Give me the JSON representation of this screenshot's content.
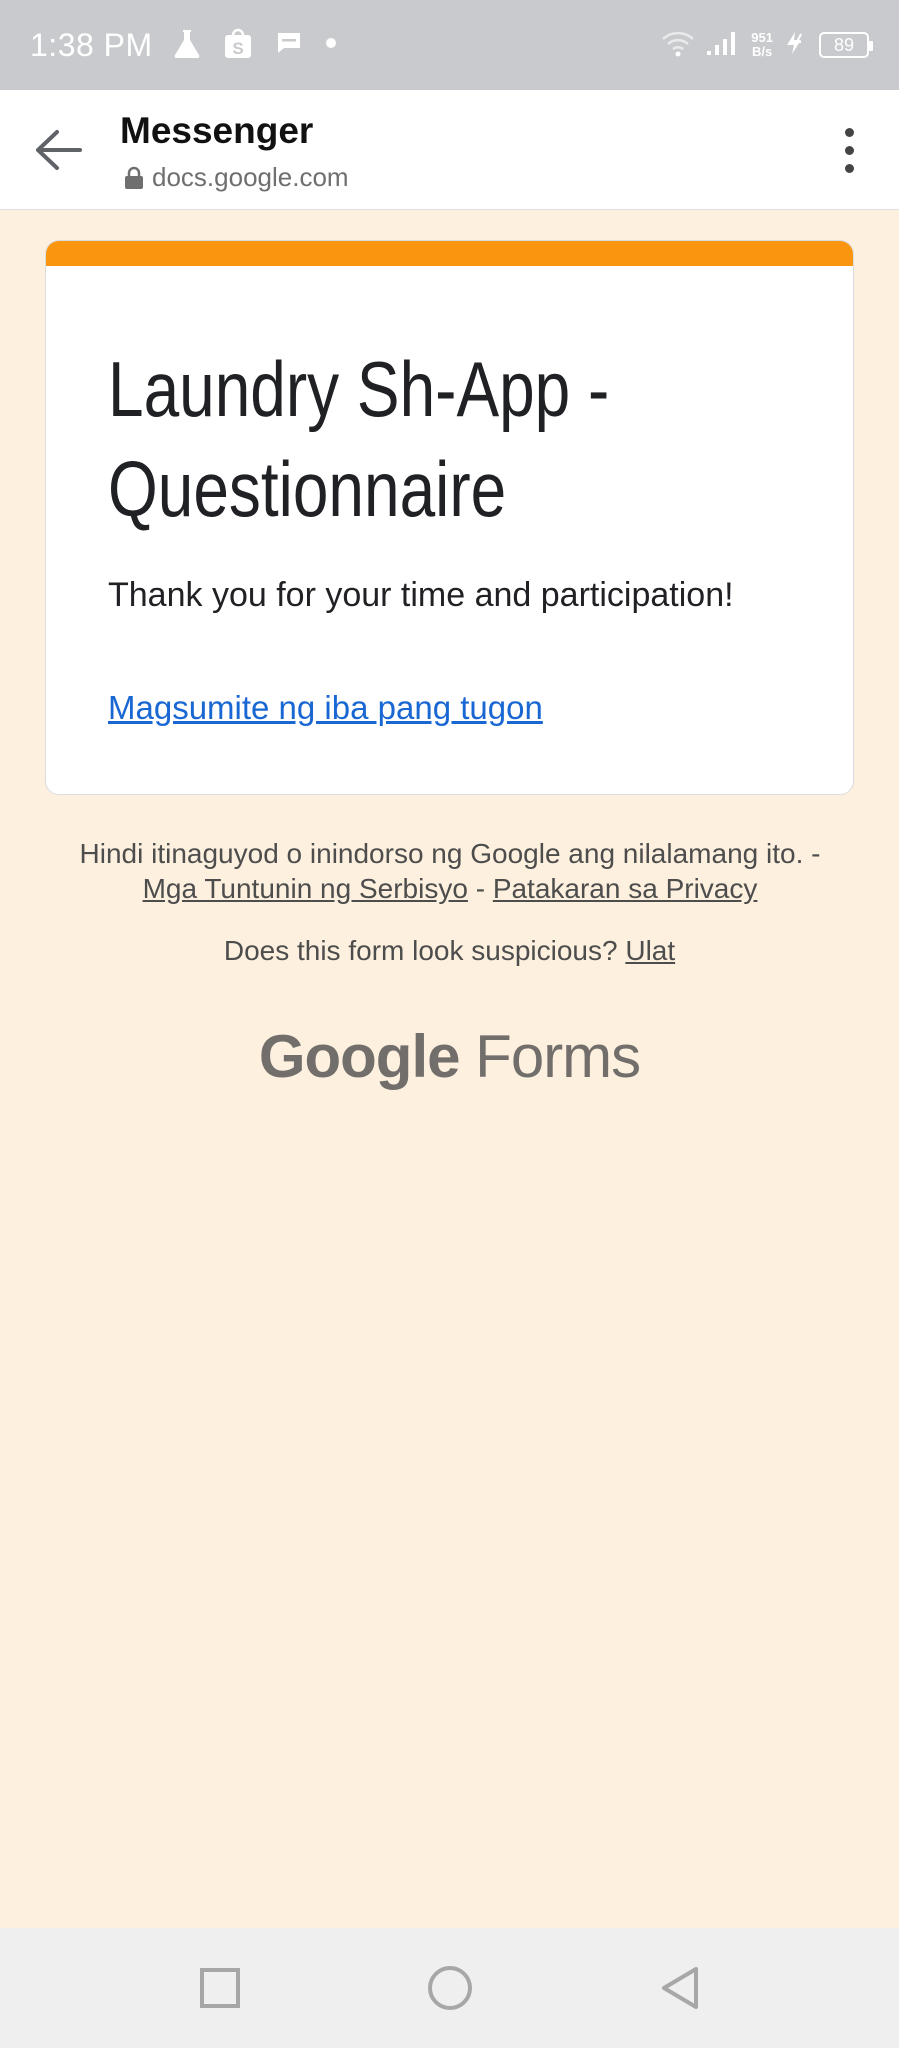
{
  "status_bar": {
    "time": "1:38 PM",
    "net_speed_value": "951",
    "net_speed_unit": "B/s",
    "battery": "89",
    "icons": [
      "flask-icon",
      "shopping-bag-icon",
      "message-icon",
      "dot-icon",
      "wifi-icon",
      "signal-icon",
      "charging-icon",
      "battery-icon"
    ]
  },
  "app_bar": {
    "title": "Messenger",
    "url": "docs.google.com"
  },
  "form": {
    "accent_color": "#f9950f",
    "title_line1": "Laundry Sh-App -",
    "title_line2": "Questionnaire",
    "message": "Thank you for your time and participation!",
    "resubmit_link": "Magsumite ng iba pang tugon"
  },
  "footer": {
    "disclaimer_prefix": "Hindi itinaguyod o inindorso ng Google ang nilalamang ito. - ",
    "terms_link": "Mga Tuntunin ng Serbisyo",
    "separator": " - ",
    "privacy_link": "Patakaran sa Privacy",
    "suspicious_text": "Does this form look suspicious? ",
    "report_link": "Ulat",
    "logo_google": "Google",
    "logo_forms": "Forms"
  }
}
